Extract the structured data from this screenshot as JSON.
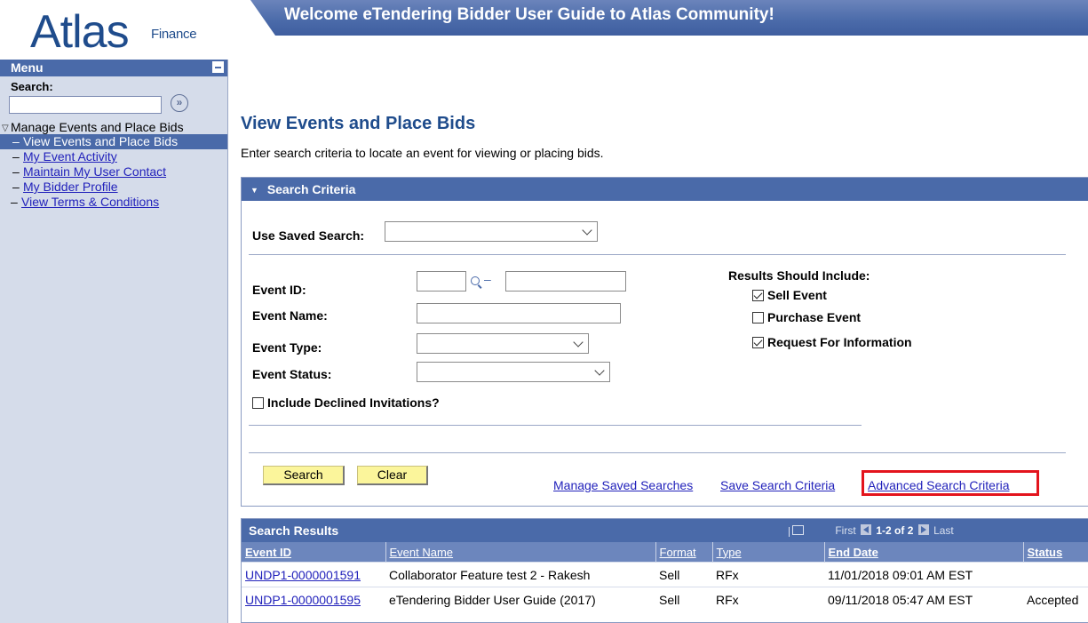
{
  "header": {
    "logo_main": "Atlas",
    "logo_sub": "Finance",
    "banner": "Welcome eTendering Bidder User Guide to Atlas Community!"
  },
  "menu": {
    "title": "Menu",
    "search_label": "Search:",
    "search_value": "",
    "folder": "Manage Events and Place Bids",
    "items": [
      {
        "label": "View Events and Place Bids",
        "selected": true
      },
      {
        "label": "My Event Activity"
      },
      {
        "label": "Maintain My User Contact"
      },
      {
        "label": "My Bidder Profile"
      }
    ],
    "top_item": "View Terms & Conditions"
  },
  "page": {
    "title": "View Events and Place Bids",
    "instructions": "Enter search criteria to locate an event for viewing or placing bids."
  },
  "search": {
    "panel_title": "Search Criteria",
    "saved_search_label": "Use Saved Search:",
    "saved_search_value": "",
    "event_id_label": "Event ID:",
    "event_id_from": "",
    "event_id_to": "",
    "event_name_label": "Event Name:",
    "event_name_value": "",
    "event_type_label": "Event Type:",
    "event_type_value": "",
    "event_status_label": "Event Status:",
    "event_status_value": "",
    "include_declined_label": "Include Declined Invitations?",
    "include_declined_checked": false,
    "results_include_label": "Results Should Include:",
    "include_options": [
      {
        "label": "Sell Event",
        "checked": true
      },
      {
        "label": "Purchase Event",
        "checked": false
      },
      {
        "label": "Request For Information",
        "checked": true
      }
    ],
    "search_button": "Search",
    "clear_button": "Clear",
    "manage_saved_link": "Manage Saved Searches",
    "save_criteria_link": "Save Search Criteria",
    "advanced_link": "Advanced Search Criteria"
  },
  "results": {
    "title": "Search Results",
    "nav_first": "First",
    "nav_count": "1-2 of 2",
    "nav_last": "Last",
    "columns": [
      "Event ID",
      "Event Name",
      "Format",
      "Type",
      "End Date",
      "Status"
    ],
    "rows": [
      {
        "event_id": "UNDP1-0000001591",
        "event_name": "Collaborator Feature test 2 - Rakesh",
        "format": "Sell",
        "type": "RFx",
        "end_date": "11/01/2018 09:01 AM EST",
        "status": ""
      },
      {
        "event_id": "UNDP1-0000001595",
        "event_name": "eTendering Bidder User Guide (2017)",
        "format": "Sell",
        "type": "RFx",
        "end_date": "09/11/2018 05:47 AM EST",
        "status": "Accepted"
      }
    ]
  },
  "colors": {
    "header_blue": "#4a6aa9",
    "title_blue": "#1f4c8c",
    "button_yellow": "#fbf59b",
    "highlight_red": "#e3141d"
  }
}
